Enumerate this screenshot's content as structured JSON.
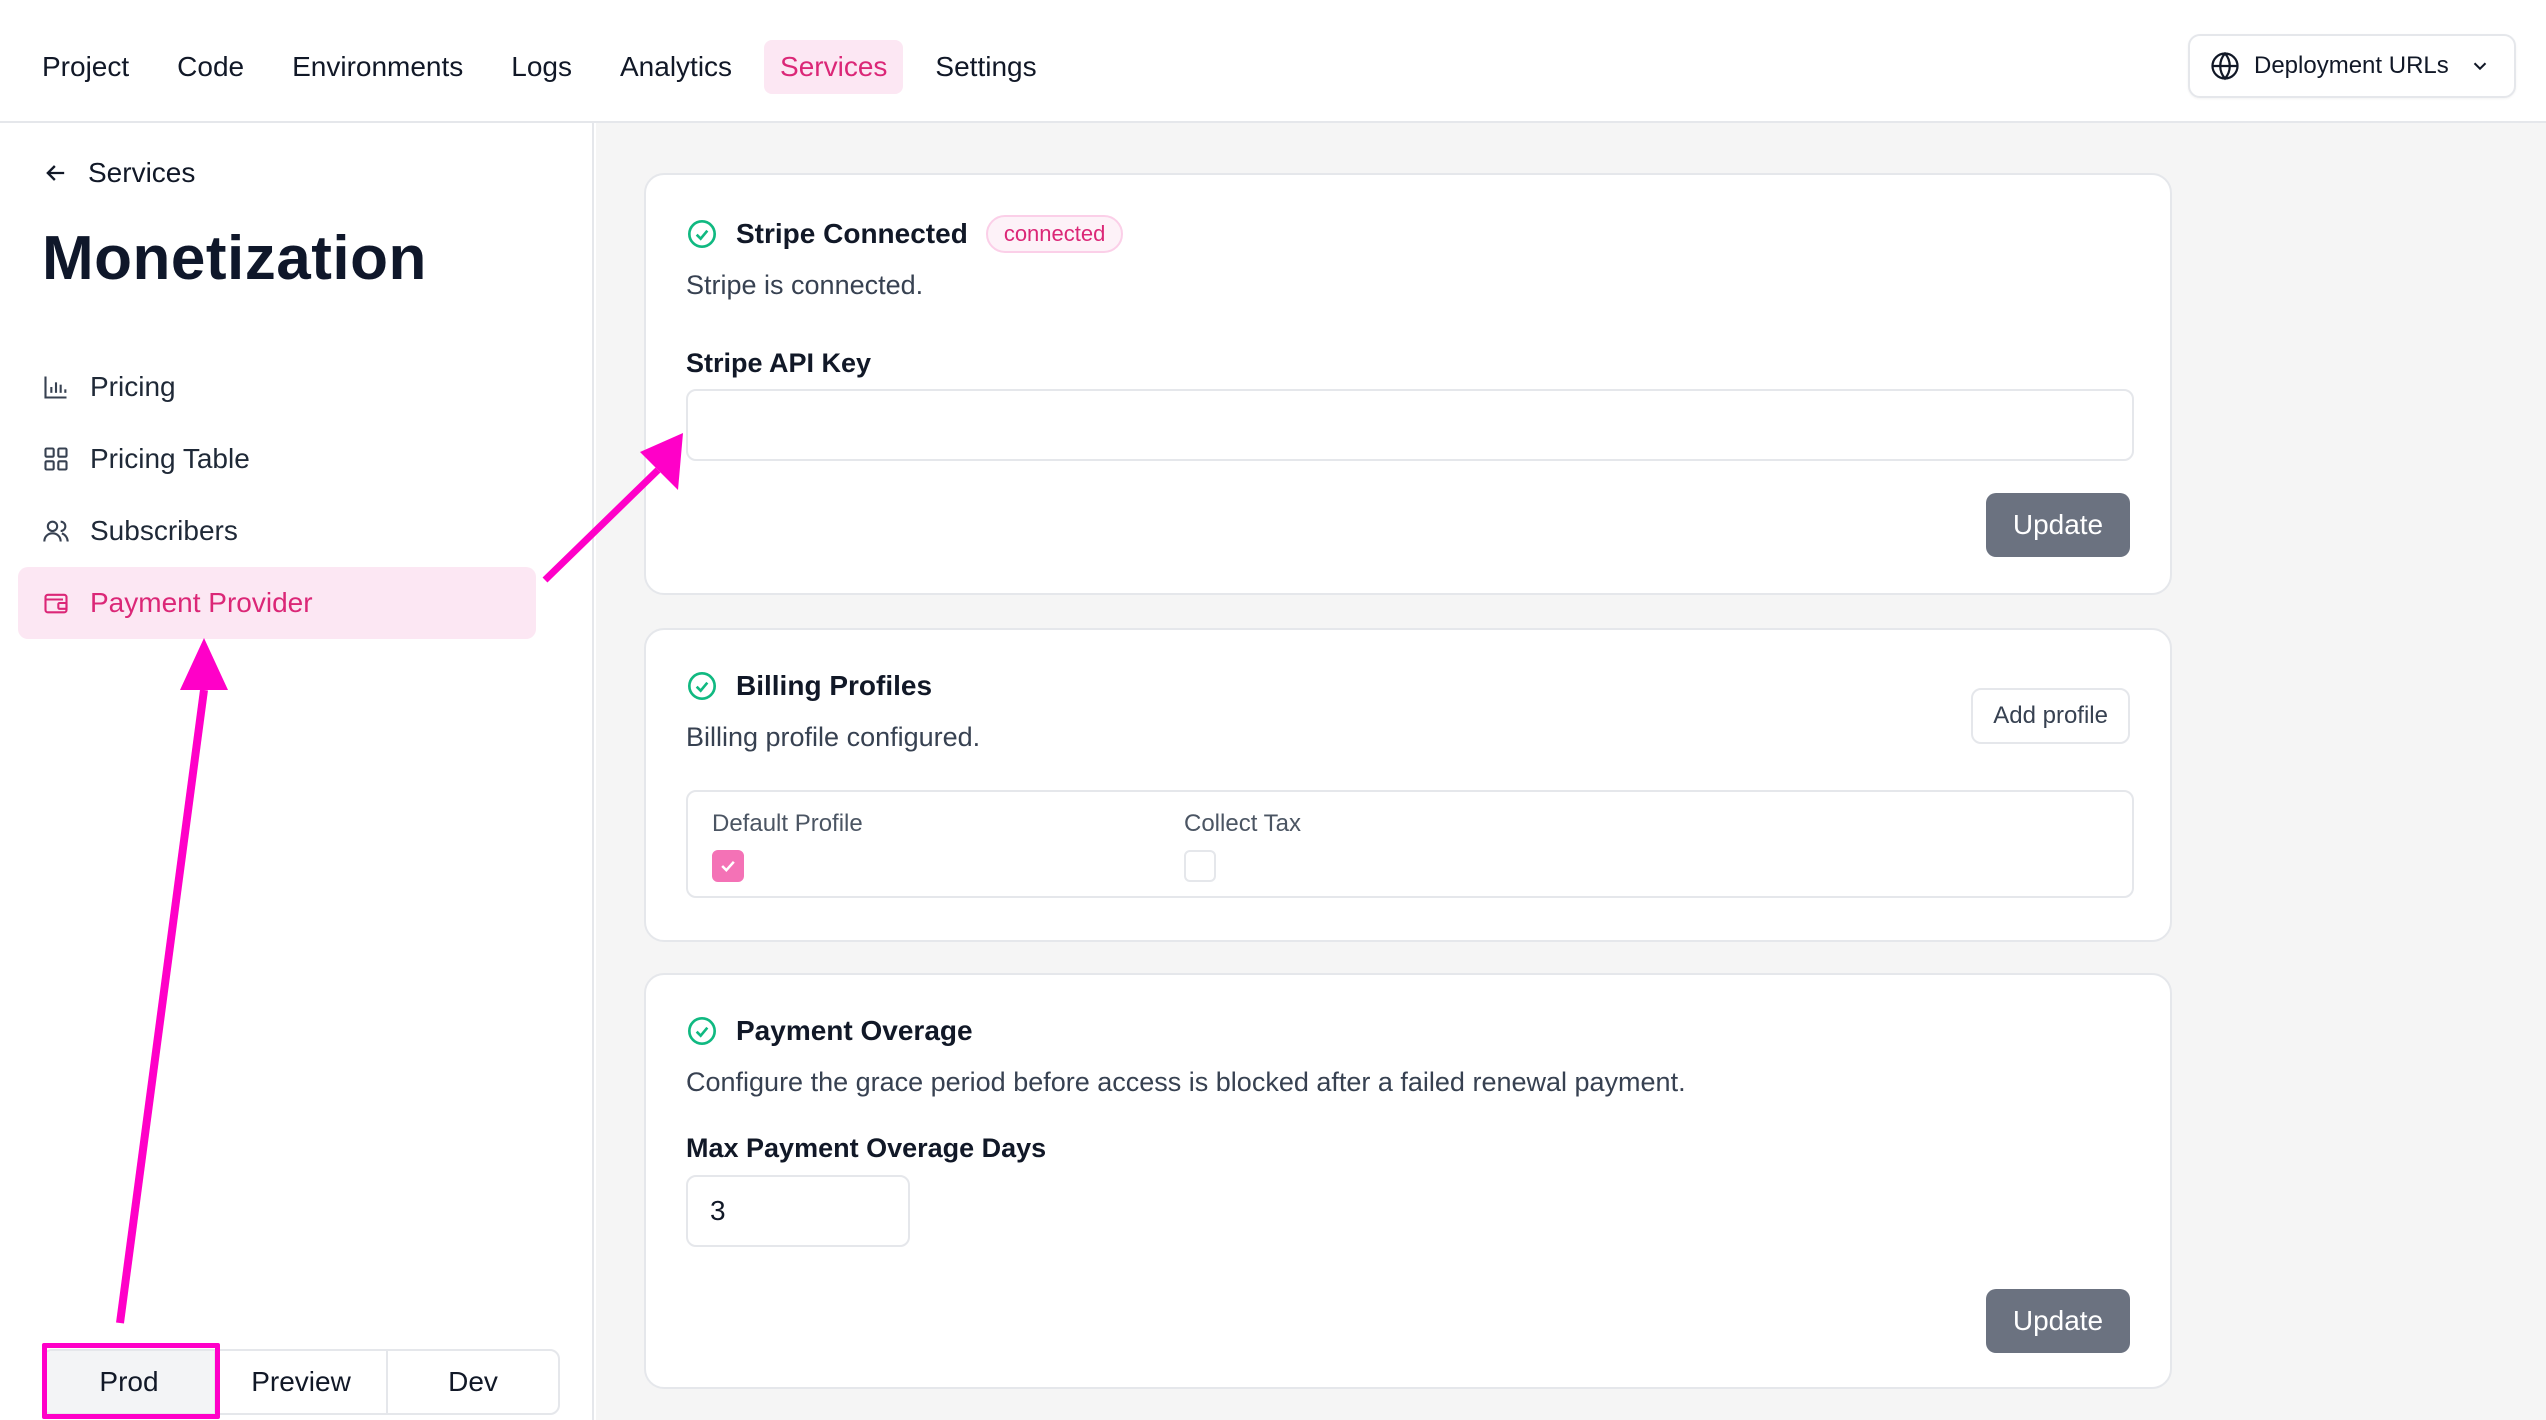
{
  "nav": {
    "items": [
      {
        "label": "Project"
      },
      {
        "label": "Code"
      },
      {
        "label": "Environments"
      },
      {
        "label": "Logs"
      },
      {
        "label": "Analytics"
      },
      {
        "label": "Services",
        "active": true
      },
      {
        "label": "Settings"
      }
    ],
    "deploy_button": {
      "label": "Deployment URLs",
      "icon": "globe-icon",
      "chevron": "chevron-down-icon"
    }
  },
  "sidebar": {
    "back_label": "Services",
    "title": "Monetization",
    "items": [
      {
        "label": "Pricing",
        "icon": "bar-chart-icon"
      },
      {
        "label": "Pricing Table",
        "icon": "grid-icon"
      },
      {
        "label": "Subscribers",
        "icon": "users-icon"
      },
      {
        "label": "Payment Provider",
        "icon": "wallet-icon",
        "active": true
      }
    ],
    "env_tabs": [
      {
        "label": "Prod",
        "active": true
      },
      {
        "label": "Preview"
      },
      {
        "label": "Dev"
      }
    ]
  },
  "stripe": {
    "title": "Stripe Connected",
    "badge": "connected",
    "description": "Stripe is connected.",
    "api_key_label": "Stripe API Key",
    "api_key_value": "",
    "update_label": "Update"
  },
  "billing": {
    "title": "Billing Profiles",
    "description": "Billing profile configured.",
    "add_label": "Add profile",
    "columns": [
      "Default Profile",
      "Collect Tax"
    ],
    "default_profile_checked": true,
    "collect_tax_checked": false
  },
  "overage": {
    "title": "Payment Overage",
    "description": "Configure the grace period before access is blocked after a failed renewal payment.",
    "field_label": "Max Payment Overage Days",
    "field_value": "3",
    "update_label": "Update"
  },
  "colors": {
    "accent": "#db2777",
    "accent_bg": "#fce7f3",
    "annotation": "#ff00c8",
    "success": "#10b981",
    "button_dark": "#6b7280"
  }
}
